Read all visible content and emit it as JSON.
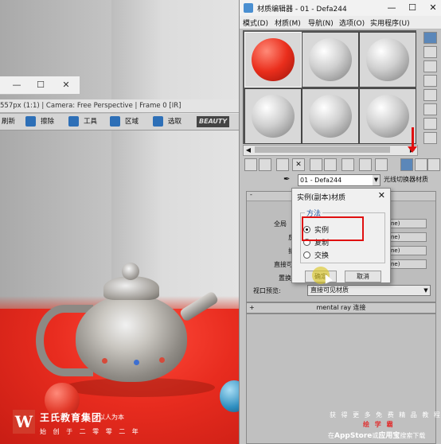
{
  "viewport": {
    "mini_window_buttons": [
      "—",
      "☐",
      "✕"
    ],
    "title": "557px (1:1) | Camera: Free Perspective | Frame 0 [IR]",
    "toolbar": {
      "item0": "刷新",
      "item1": "擦除",
      "item2": "工具",
      "item3": "区域",
      "item4": "选取",
      "beauty": "BEAUTY"
    }
  },
  "brand": {
    "logo": "W",
    "name": "王氏教育集团",
    "motto": "以人为本",
    "sub": "始 创 于 二 零 零 二 年"
  },
  "material_editor": {
    "title": "材质编辑器 - 01 - Defa244",
    "title_buttons": [
      "—",
      "☐",
      "✕"
    ],
    "menu": [
      "模式(D)",
      "材质(M)",
      "导航(N)",
      "选项(O)",
      "实用程序(U)"
    ],
    "material_name": "01 - Defa244",
    "material_type": "光线切换器材质",
    "rollout_labels": {
      "l1": "不",
      "l2": "全局",
      "l3": "反",
      "l4": "折",
      "l5": "直接可",
      "l6": "置换",
      "l7": "视口预览:"
    },
    "rollout_fields": {
      "f1": "ne)",
      "f2": "ne)",
      "f3": "ne)",
      "f4": "ne)"
    },
    "viewport_preview": "直接可见材质",
    "mental_ray_bar": "mental ray 连接",
    "plus": "+",
    "minus": "-"
  },
  "dialog": {
    "title": "实例(副本)材质",
    "close": "✕",
    "group_label": "方法",
    "options": [
      "实例",
      "复制",
      "交换"
    ],
    "selected": "实例",
    "ok": "确定",
    "cancel": "取消"
  },
  "promo": {
    "line1": "获 得 更 多 免 费 精 品 教 程",
    "line2": "绘 学 霸",
    "line3_pre": "在",
    "line3_appstore": "AppStore",
    "line3_mid": "或",
    "line3_app": "应用宝",
    "line3_post": "搜索下载"
  },
  "colors": {
    "accent_red": "#e01010",
    "selection_blue": "#5b87b9",
    "brand_red": "#d23a2a"
  }
}
